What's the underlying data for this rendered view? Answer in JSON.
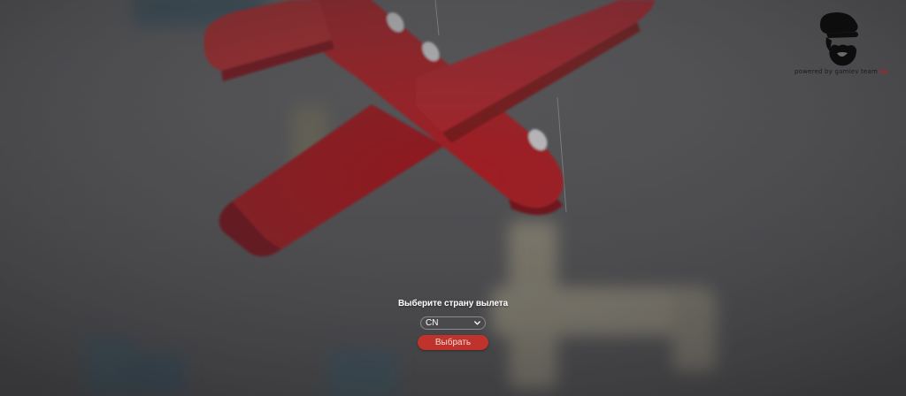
{
  "brand": {
    "logo_icon": "bearded-man-cap-icon",
    "caption": "powered by gamiev team",
    "caption_suffix": "ru"
  },
  "form": {
    "prompt": "Выберите страну вылета",
    "country_select": {
      "selected": "CN",
      "icon": "chevron-down-icon"
    },
    "submit_label": "Выбрать"
  },
  "colors": {
    "button": "#c0322c",
    "plane_red": "#c62127",
    "background": "#5c5c5e"
  }
}
